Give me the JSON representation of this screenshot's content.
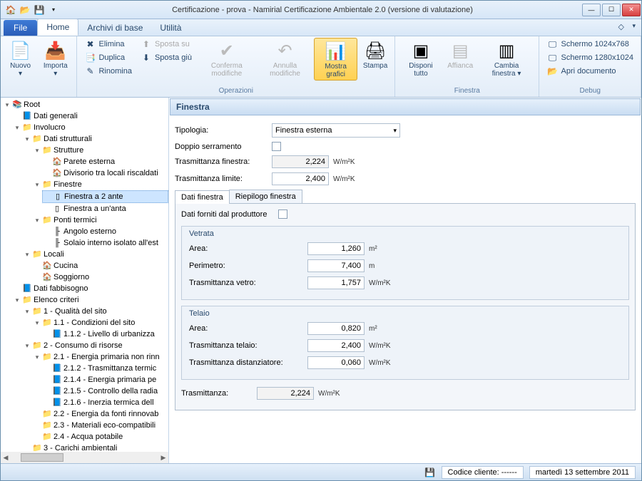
{
  "window": {
    "title": "Certificazione - prova - Namirial Certificazione Ambientale 2.0 (versione di valutazione)"
  },
  "menu": {
    "file": "File",
    "tabs": [
      "Home",
      "Archivi di base",
      "Utilità"
    ],
    "active": 0
  },
  "ribbon": {
    "groups": [
      {
        "label": "",
        "big": [
          {
            "icon": "📄",
            "label": "Nuovo",
            "caret": true
          },
          {
            "icon": "📥",
            "label": "Importa",
            "caret": true
          }
        ]
      },
      {
        "label": "Operazioni",
        "small": [
          {
            "icon": "✖",
            "label": "Elimina"
          },
          {
            "icon": "📑",
            "label": "Duplica"
          },
          {
            "icon": "✎",
            "label": "Rinomina"
          }
        ],
        "small2": [
          {
            "icon": "⬆",
            "label": "Sposta su",
            "disabled": true
          },
          {
            "icon": "⬇",
            "label": "Sposta giù"
          }
        ],
        "big": [
          {
            "icon": "✔",
            "label": "Conferma modifiche",
            "disabled": true
          },
          {
            "icon": "↶",
            "label": "Annulla modifiche",
            "disabled": true
          },
          {
            "icon": "📊",
            "label": "Mostra grafici",
            "highlight": true
          },
          {
            "icon": "🖨",
            "label": "Stampa"
          }
        ]
      },
      {
        "label": "Finestra",
        "big": [
          {
            "icon": "▣",
            "label": "Disponi tutto"
          },
          {
            "icon": "▤",
            "label": "Affianca",
            "disabled": true
          },
          {
            "icon": "▥",
            "label": "Cambia finestra",
            "caret": true
          }
        ]
      },
      {
        "label": "Debug",
        "small": [
          {
            "icon": "🖵",
            "label": "Schermo 1024x768"
          },
          {
            "icon": "🖵",
            "label": "Schermo 1280x1024"
          },
          {
            "icon": "📂",
            "label": "Apri documento"
          }
        ]
      }
    ]
  },
  "tree": {
    "root": "Root",
    "items": [
      {
        "label": "Dati generali",
        "icon": "📘"
      },
      {
        "label": "Involucro",
        "icon": "📁",
        "children": [
          {
            "label": "Dati strutturali",
            "icon": "📁",
            "children": [
              {
                "label": "Strutture",
                "icon": "📁",
                "children": [
                  {
                    "label": "Parete esterna",
                    "icon": "🏠"
                  },
                  {
                    "label": "Divisorio tra locali riscaldati",
                    "icon": "🏠"
                  }
                ]
              },
              {
                "label": "Finestre",
                "icon": "📁",
                "children": [
                  {
                    "label": "Finestra a 2 ante",
                    "icon": "▯",
                    "selected": true
                  },
                  {
                    "label": "Finestra a un'anta",
                    "icon": "▯"
                  }
                ]
              },
              {
                "label": "Ponti termici",
                "icon": "📁",
                "children": [
                  {
                    "label": "Angolo esterno",
                    "icon": "╟"
                  },
                  {
                    "label": "Solaio interno isolato all'est",
                    "icon": "╟"
                  }
                ]
              }
            ]
          },
          {
            "label": "Locali",
            "icon": "📁",
            "children": [
              {
                "label": "Cucina",
                "icon": "🏠"
              },
              {
                "label": "Soggiorno",
                "icon": "🏠"
              }
            ]
          }
        ]
      },
      {
        "label": "Dati fabbisogno",
        "icon": "📘"
      },
      {
        "label": "Elenco criteri",
        "icon": "📁",
        "children": [
          {
            "label": "1 - Qualità del sito",
            "icon": "📁",
            "children": [
              {
                "label": "1.1 - Condizioni del sito",
                "icon": "📁",
                "children": [
                  {
                    "label": "1.1.2 - Livello di urbanizza",
                    "icon": "📘"
                  }
                ]
              }
            ]
          },
          {
            "label": "2 - Consumo di risorse",
            "icon": "📁",
            "children": [
              {
                "label": "2.1 - Energia primaria non rinn",
                "icon": "📁",
                "children": [
                  {
                    "label": "2.1.2 - Trasmittanza termic",
                    "icon": "📘"
                  },
                  {
                    "label": "2.1.4 - Energia primaria pe",
                    "icon": "📘"
                  },
                  {
                    "label": "2.1.5 - Controllo della radia",
                    "icon": "📘"
                  },
                  {
                    "label": "2.1.6 - Inerzia termica dell",
                    "icon": "📘"
                  }
                ]
              },
              {
                "label": "2.2 - Energia da fonti rinnovab",
                "icon": "📁"
              },
              {
                "label": "2.3 - Materiali eco-compatibili",
                "icon": "📁"
              },
              {
                "label": "2.4 - Acqua potabile",
                "icon": "📁"
              }
            ]
          },
          {
            "label": "3 - Carichi ambientali",
            "icon": "📁"
          }
        ]
      }
    ]
  },
  "form": {
    "header": "Finestra",
    "tipologia_label": "Tipologia:",
    "tipologia_value": "Finestra esterna",
    "doppio_label": "Doppio serramento",
    "trans_fin_label": "Trasmittanza finestra:",
    "trans_fin_value": "2,224",
    "trans_lim_label": "Trasmittanza limite:",
    "trans_lim_value": "2,400",
    "unit_w": "W/m²K",
    "subtabs": [
      "Dati finestra",
      "Riepilogo finestra"
    ],
    "dati_forniti": "Dati forniti dal produttore",
    "vetrata": {
      "title": "Vetrata",
      "area_label": "Area:",
      "area": "1,260",
      "area_u": "m²",
      "perim_label": "Perimetro:",
      "perim": "7,400",
      "perim_u": "m",
      "trans_label": "Trasmittanza vetro:",
      "trans": "1,757"
    },
    "telaio": {
      "title": "Telaio",
      "area_label": "Area:",
      "area": "0,820",
      "area_u": "m²",
      "trans_label": "Trasmittanza telaio:",
      "trans": "2,400",
      "dist_label": "Trasmittanza distanziatore:",
      "dist": "0,060"
    },
    "final_label": "Trasmittanza:",
    "final_value": "2,224"
  },
  "status": {
    "codice_label": "Codice cliente:",
    "codice": "------",
    "data": "martedì 13 settembre 2011"
  }
}
